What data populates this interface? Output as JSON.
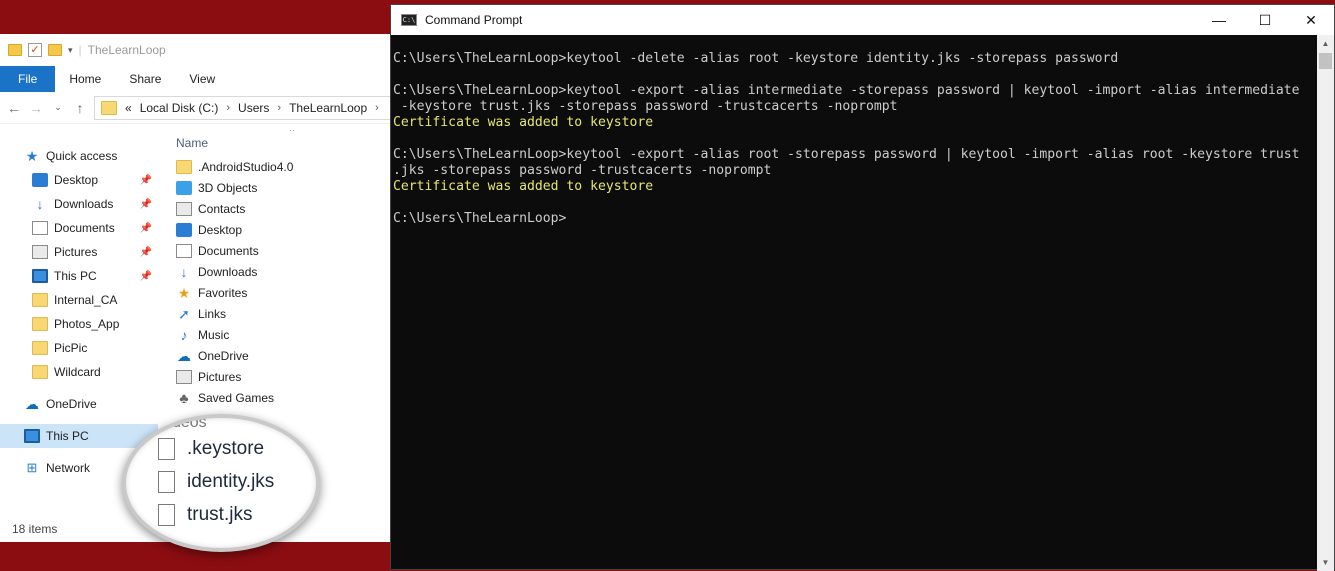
{
  "explorer": {
    "title": "TheLearnLoop",
    "ribbon_tabs": [
      "File",
      "Home",
      "Share",
      "View"
    ],
    "address": {
      "prefix": "«",
      "segments": [
        "Local Disk (C:)",
        "Users",
        "TheLearnLoop"
      ],
      "separator": "›"
    },
    "nav": [
      {
        "label": "Quick access",
        "icon": "star-icon",
        "level": "top"
      },
      {
        "label": "Desktop",
        "icon": "desktop-icon",
        "level": "sub",
        "pinned": true
      },
      {
        "label": "Downloads",
        "icon": "download-icon",
        "level": "sub",
        "pinned": true
      },
      {
        "label": "Documents",
        "icon": "document-icon",
        "level": "sub",
        "pinned": true
      },
      {
        "label": "Pictures",
        "icon": "pictures-icon",
        "level": "sub",
        "pinned": true
      },
      {
        "label": "This PC",
        "icon": "computer-icon",
        "level": "sub",
        "pinned": true
      },
      {
        "label": "Internal_CA",
        "icon": "folder-icon",
        "level": "sub"
      },
      {
        "label": "Photos_App",
        "icon": "folder-icon",
        "level": "sub"
      },
      {
        "label": "PicPic",
        "icon": "folder-icon",
        "level": "sub"
      },
      {
        "label": "Wildcard",
        "icon": "folder-icon",
        "level": "sub"
      },
      {
        "label": "OneDrive",
        "icon": "cloud-icon",
        "level": "top"
      },
      {
        "label": "This PC",
        "icon": "computer-icon",
        "level": "top",
        "selected": true
      },
      {
        "label": "Network",
        "icon": "network-icon",
        "level": "top"
      }
    ],
    "column_header": "Name",
    "files": [
      {
        "name": ".AndroidStudio4.0",
        "icon": "folder-icon"
      },
      {
        "name": "3D Objects",
        "icon": "cube-icon"
      },
      {
        "name": "Contacts",
        "icon": "contacts-icon"
      },
      {
        "name": "Desktop",
        "icon": "desktop-icon"
      },
      {
        "name": "Documents",
        "icon": "document-icon"
      },
      {
        "name": "Downloads",
        "icon": "download-icon"
      },
      {
        "name": "Favorites",
        "icon": "star-icon"
      },
      {
        "name": "Links",
        "icon": "link-icon"
      },
      {
        "name": "Music",
        "icon": "music-icon"
      },
      {
        "name": "OneDrive",
        "icon": "cloud-icon"
      },
      {
        "name": "Pictures",
        "icon": "pictures-icon"
      },
      {
        "name": "Saved Games",
        "icon": "games-icon"
      }
    ],
    "status": "18 items",
    "magnified": {
      "cut_label": "Videos",
      "files": [
        ".keystore",
        "identity.jks",
        "trust.jks"
      ]
    }
  },
  "cmd": {
    "title": "Command Prompt",
    "lines": [
      {
        "text": "C:\\Users\\TheLearnLoop>keytool -delete -alias root -keystore identity.jks -storepass password",
        "kind": "normal"
      },
      {
        "text": "",
        "kind": "normal"
      },
      {
        "text": "C:\\Users\\TheLearnLoop>keytool -export -alias intermediate -storepass password | keytool -import -alias intermediate",
        "kind": "normal"
      },
      {
        "text": " -keystore trust.jks -storepass password -trustcacerts -noprompt",
        "kind": "normal"
      },
      {
        "text": "Certificate was added to keystore",
        "kind": "ok"
      },
      {
        "text": "",
        "kind": "normal"
      },
      {
        "text": "C:\\Users\\TheLearnLoop>keytool -export -alias root -storepass password | keytool -import -alias root -keystore trust",
        "kind": "normal"
      },
      {
        "text": ".jks -storepass password -trustcacerts -noprompt",
        "kind": "normal"
      },
      {
        "text": "Certificate was added to keystore",
        "kind": "ok"
      },
      {
        "text": "",
        "kind": "normal"
      },
      {
        "text": "C:\\Users\\TheLearnLoop>",
        "kind": "normal"
      }
    ]
  }
}
